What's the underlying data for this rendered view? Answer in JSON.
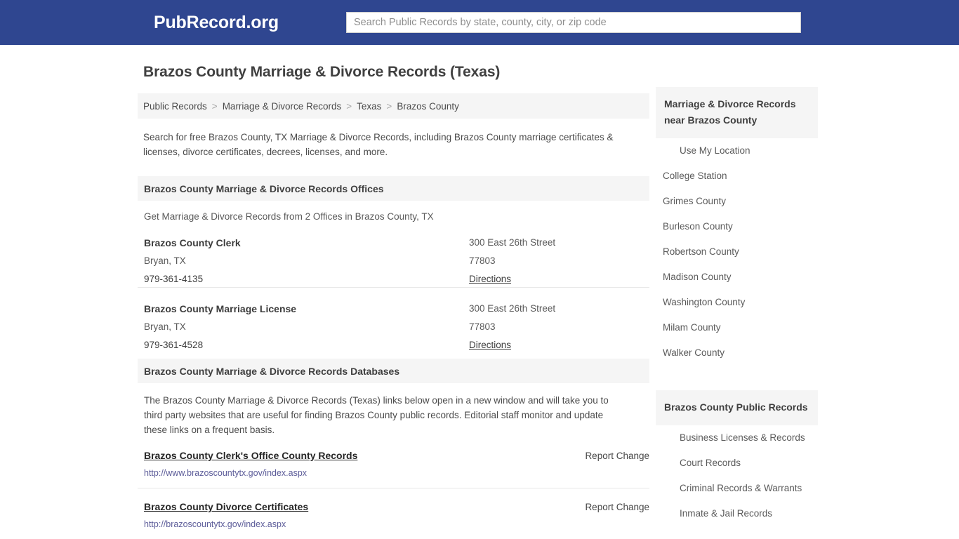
{
  "header": {
    "brand": "PubRecord.org",
    "search_placeholder": "Search Public Records by state, county, city, or zip code",
    "search_value": "",
    "background_color": "#2f4690"
  },
  "page": {
    "title": "Brazos County Marriage & Divorce Records (Texas)",
    "intro": "Search for free Brazos County, TX Marriage & Divorce Records, including Brazos County marriage certificates & licenses, divorce certificates, decrees, licenses, and more."
  },
  "breadcrumb": {
    "items": [
      {
        "label": "Public Records"
      },
      {
        "label": "Marriage & Divorce Records"
      },
      {
        "label": "Texas"
      },
      {
        "label": "Brazos County"
      }
    ],
    "separator": ">"
  },
  "offices_section": {
    "heading": "Brazos County Marriage & Divorce Records Offices",
    "note": "Get Marriage & Divorce Records from 2 Offices in Brazos County, TX",
    "offices": [
      {
        "name": "Brazos County Clerk",
        "city_state": "Bryan, TX",
        "phone": "979-361-4135",
        "street": "300 East 26th Street",
        "zip": "77803",
        "directions_label": "Directions"
      },
      {
        "name": "Brazos County Marriage License",
        "city_state": "Bryan, TX",
        "phone": "979-361-4528",
        "street": "300 East 26th Street",
        "zip": "77803",
        "directions_label": "Directions"
      }
    ]
  },
  "databases_section": {
    "heading": "Brazos County Marriage & Divorce Records Databases",
    "intro": "The Brazos County Marriage & Divorce Records (Texas) links below open in a new window and will take you to third party websites that are useful for finding Brazos County public records. Editorial staff monitor and update these links on a frequent basis.",
    "report_change_label": "Report Change",
    "entries": [
      {
        "title": "Brazos County Clerk's Office County Records",
        "url": "http://www.brazoscountytx.gov/index.aspx",
        "report_change_label": "Report Change"
      },
      {
        "title": "Brazos County Divorce Certificates",
        "url": "http://brazoscountytx.gov/index.aspx",
        "report_change_label": "Report Change"
      }
    ]
  },
  "sidebar": {
    "nearby": {
      "heading": "Marriage & Divorce Records near Brazos County",
      "items": [
        {
          "label": "Use My Location",
          "indented": true
        },
        {
          "label": "College Station",
          "indented": false
        },
        {
          "label": "Grimes County",
          "indented": false
        },
        {
          "label": "Burleson County",
          "indented": false
        },
        {
          "label": "Robertson County",
          "indented": false
        },
        {
          "label": "Madison County",
          "indented": false
        },
        {
          "label": "Washington County",
          "indented": false
        },
        {
          "label": "Milam County",
          "indented": false
        },
        {
          "label": "Walker County",
          "indented": false
        }
      ]
    },
    "public_records": {
      "heading": "Brazos County Public Records",
      "items": [
        {
          "label": "Business Licenses & Records"
        },
        {
          "label": "Court Records"
        },
        {
          "label": "Criminal Records & Warrants"
        },
        {
          "label": "Inmate & Jail Records"
        }
      ]
    }
  }
}
